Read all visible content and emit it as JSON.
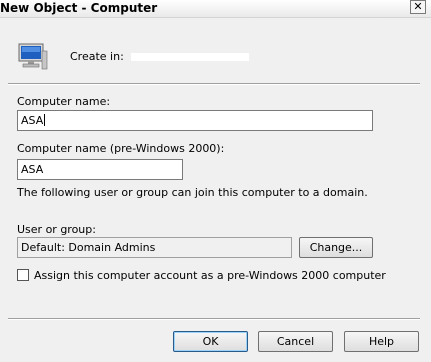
{
  "window": {
    "title": "New Object - Computer",
    "close_glyph": "✕"
  },
  "header": {
    "create_in_label": "Create in:",
    "create_in_value": ""
  },
  "form": {
    "computer_name_label": "Computer name:",
    "computer_name_value": "ASA",
    "pre2000_label": "Computer name (pre-Windows 2000):",
    "pre2000_value": "ASA",
    "join_info": "The following user or group can join this computer to a domain.",
    "user_group_label": "User or group:",
    "user_group_value": "Default: Domain Admins",
    "change_button": "Change...",
    "assign_checkbox_label": "Assign this computer account as a pre-Windows 2000 computer",
    "assign_checked": false
  },
  "buttons": {
    "ok": "OK",
    "cancel": "Cancel",
    "help": "Help"
  },
  "icons": {
    "header": "computer-icon",
    "close": "close-icon"
  },
  "colors": {
    "dialog_bg": "#f0f0f0",
    "monitor_blue": "#1e5fbf"
  }
}
